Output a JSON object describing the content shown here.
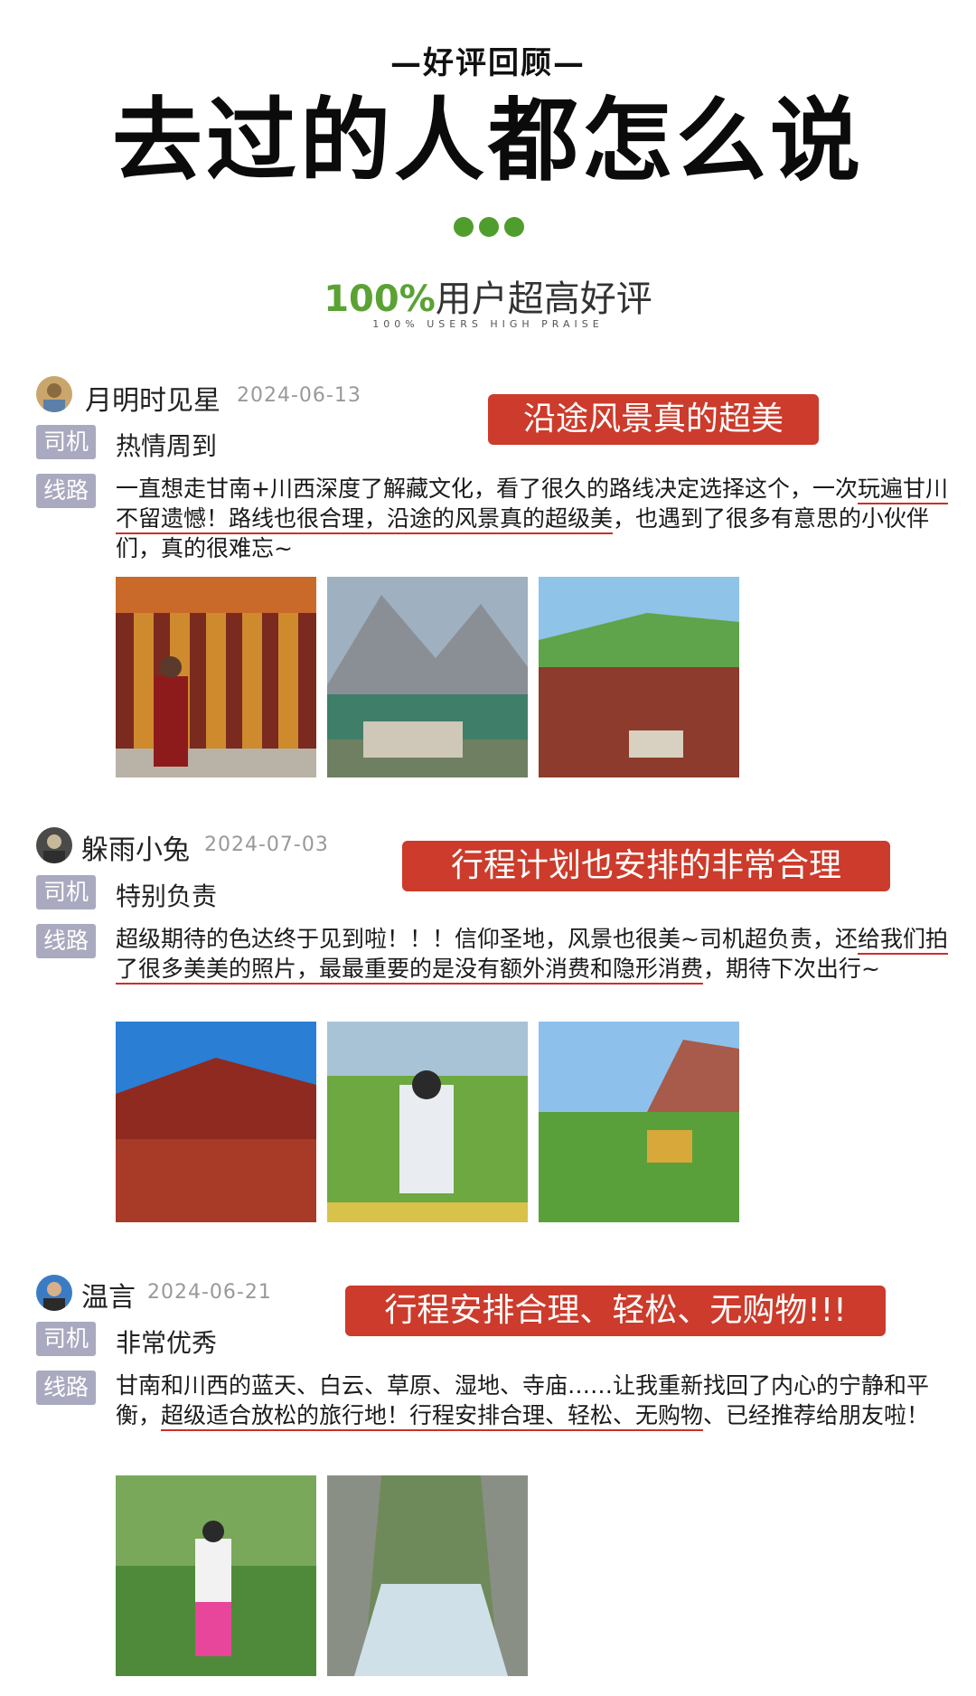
{
  "header": {
    "eyebrow": "—好评回顾—",
    "title": "去过的人都怎么说",
    "praise_pct": "100%",
    "praise_text": "用户超高好评",
    "praise_sub": "100% USERS HIGH PRAISE"
  },
  "labels": {
    "driver": "司机",
    "route": "线路"
  },
  "reviews": [
    {
      "name": "月明时见星",
      "date": "2024-06-13",
      "banner": "沿途风景真的超美",
      "driver": "热情周到",
      "text_a": "一直想走甘南+川西深度了解藏文化，看了很久的路线决定选择这个，一次",
      "text_hl": "玩遍甘川不留遗憾！路线也很合理，沿途的风景真的超级美",
      "text_b": "，也遇到了很多有意思的小伙伴们，真的很难忘~"
    },
    {
      "name": "躲雨小兔",
      "date": "2024-07-03",
      "banner": "行程计划也安排的非常合理",
      "driver": "特别负责",
      "text_a": "超级期待的色达终于见到啦！！！信仰圣地，风景也很美~司机超负责，还",
      "text_hl": "给我们拍了很多美美的照片，最最重要的是没有额外消费和隐形消费",
      "text_b": "，期待下次出行~"
    },
    {
      "name": "温言",
      "date": "2024-06-21",
      "banner": "行程安排合理、轻松、无购物!!!",
      "driver": "非常优秀",
      "text_a": "甘南和川西的蓝天、白云、草原、湿地、寺庙……让我重新找回了内心的宁静和平衡，",
      "text_hl": "超级适合放松的旅行地！行程安排合理、轻松、无购物",
      "text_b": "、已经推荐给朋友啦！"
    }
  ],
  "colors": {
    "accent_green": "#5aa234",
    "banner_red": "#cc3b2b",
    "tag_gray": "#a9a9bf"
  }
}
